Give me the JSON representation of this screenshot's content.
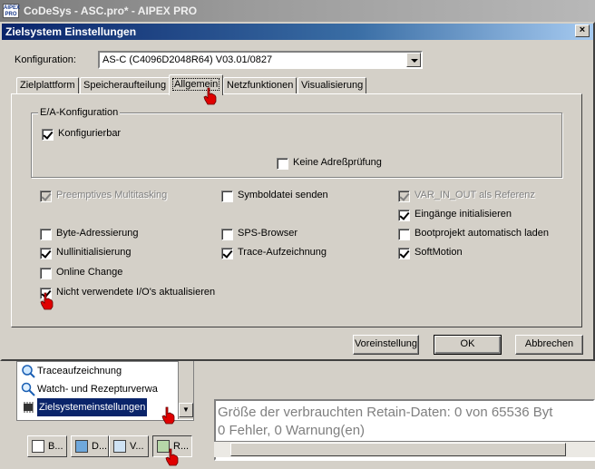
{
  "app": {
    "title": "CoDeSys - ASC.pro* - AIPEX PRO",
    "icon_text": "AIPEX PRO"
  },
  "dialog": {
    "title": "Zielsystem Einstellungen",
    "close_symbol": "×",
    "config_label": "Konfiguration:",
    "config_value": "AS-C (C4096D2048R64) V03.01/0827",
    "tabs": [
      {
        "label": "Zielplattform",
        "active": false
      },
      {
        "label": "Speicheraufteilung",
        "active": false
      },
      {
        "label": "Allgemein",
        "active": true
      },
      {
        "label": "Netzfunktionen",
        "active": false
      },
      {
        "label": "Visualisierung",
        "active": false
      }
    ],
    "group_title": "E/A-Konfiguration",
    "checkboxes": {
      "konfigurierbar": {
        "label": "Konfigurierbar",
        "checked": true,
        "enabled": true
      },
      "keine_adresspruefung": {
        "label": "Keine Adreßprüfung",
        "checked": false,
        "enabled": true
      },
      "preemptive": {
        "label": "Preemptives Multitasking",
        "checked": true,
        "enabled": false
      },
      "symboldatei": {
        "label": "Symboldatei senden",
        "checked": false,
        "enabled": true
      },
      "var_in_out": {
        "label": "VAR_IN_OUT als Referenz",
        "checked": true,
        "enabled": false
      },
      "eingaenge": {
        "label": "Eingänge initialisieren",
        "checked": true,
        "enabled": true
      },
      "byte_adressierung": {
        "label": "Byte-Adressierung",
        "checked": false,
        "enabled": true
      },
      "sps_browser": {
        "label": "SPS-Browser",
        "checked": false,
        "enabled": true
      },
      "bootprojekt": {
        "label": "Bootprojekt automatisch laden",
        "checked": false,
        "enabled": true
      },
      "nullinit": {
        "label": "Nullinitialisierung",
        "checked": true,
        "enabled": true
      },
      "trace": {
        "label": "Trace-Aufzeichnung",
        "checked": true,
        "enabled": true
      },
      "softmotion": {
        "label": "SoftMotion",
        "checked": true,
        "enabled": true
      },
      "online_change": {
        "label": "Online Change",
        "checked": false,
        "enabled": true
      },
      "nicht_verwendete": {
        "label": "Nicht verwendete I/O's aktualisieren",
        "checked": true,
        "enabled": true
      }
    },
    "buttons": {
      "defaults": "Voreinstellung",
      "ok": "OK",
      "cancel": "Abbrechen"
    }
  },
  "background": {
    "tree_items": [
      {
        "label": "Traceaufzeichnung",
        "selected": false
      },
      {
        "label": "Watch- und Rezepturverwa",
        "selected": false
      },
      {
        "label": "Zielsystemeinstellungen",
        "selected": true
      }
    ],
    "bottom_tabs": [
      "B...",
      "D...",
      "V...",
      "R..."
    ],
    "messages": [
      "Größe der verbrauchten Retain-Daten: 0 von 65536 Byt",
      "0 Fehler, 0 Warnung(en)"
    ]
  },
  "colors": {
    "face": "#d4d0c8",
    "active_title": "#0a246a",
    "selection": "#0a246a"
  }
}
